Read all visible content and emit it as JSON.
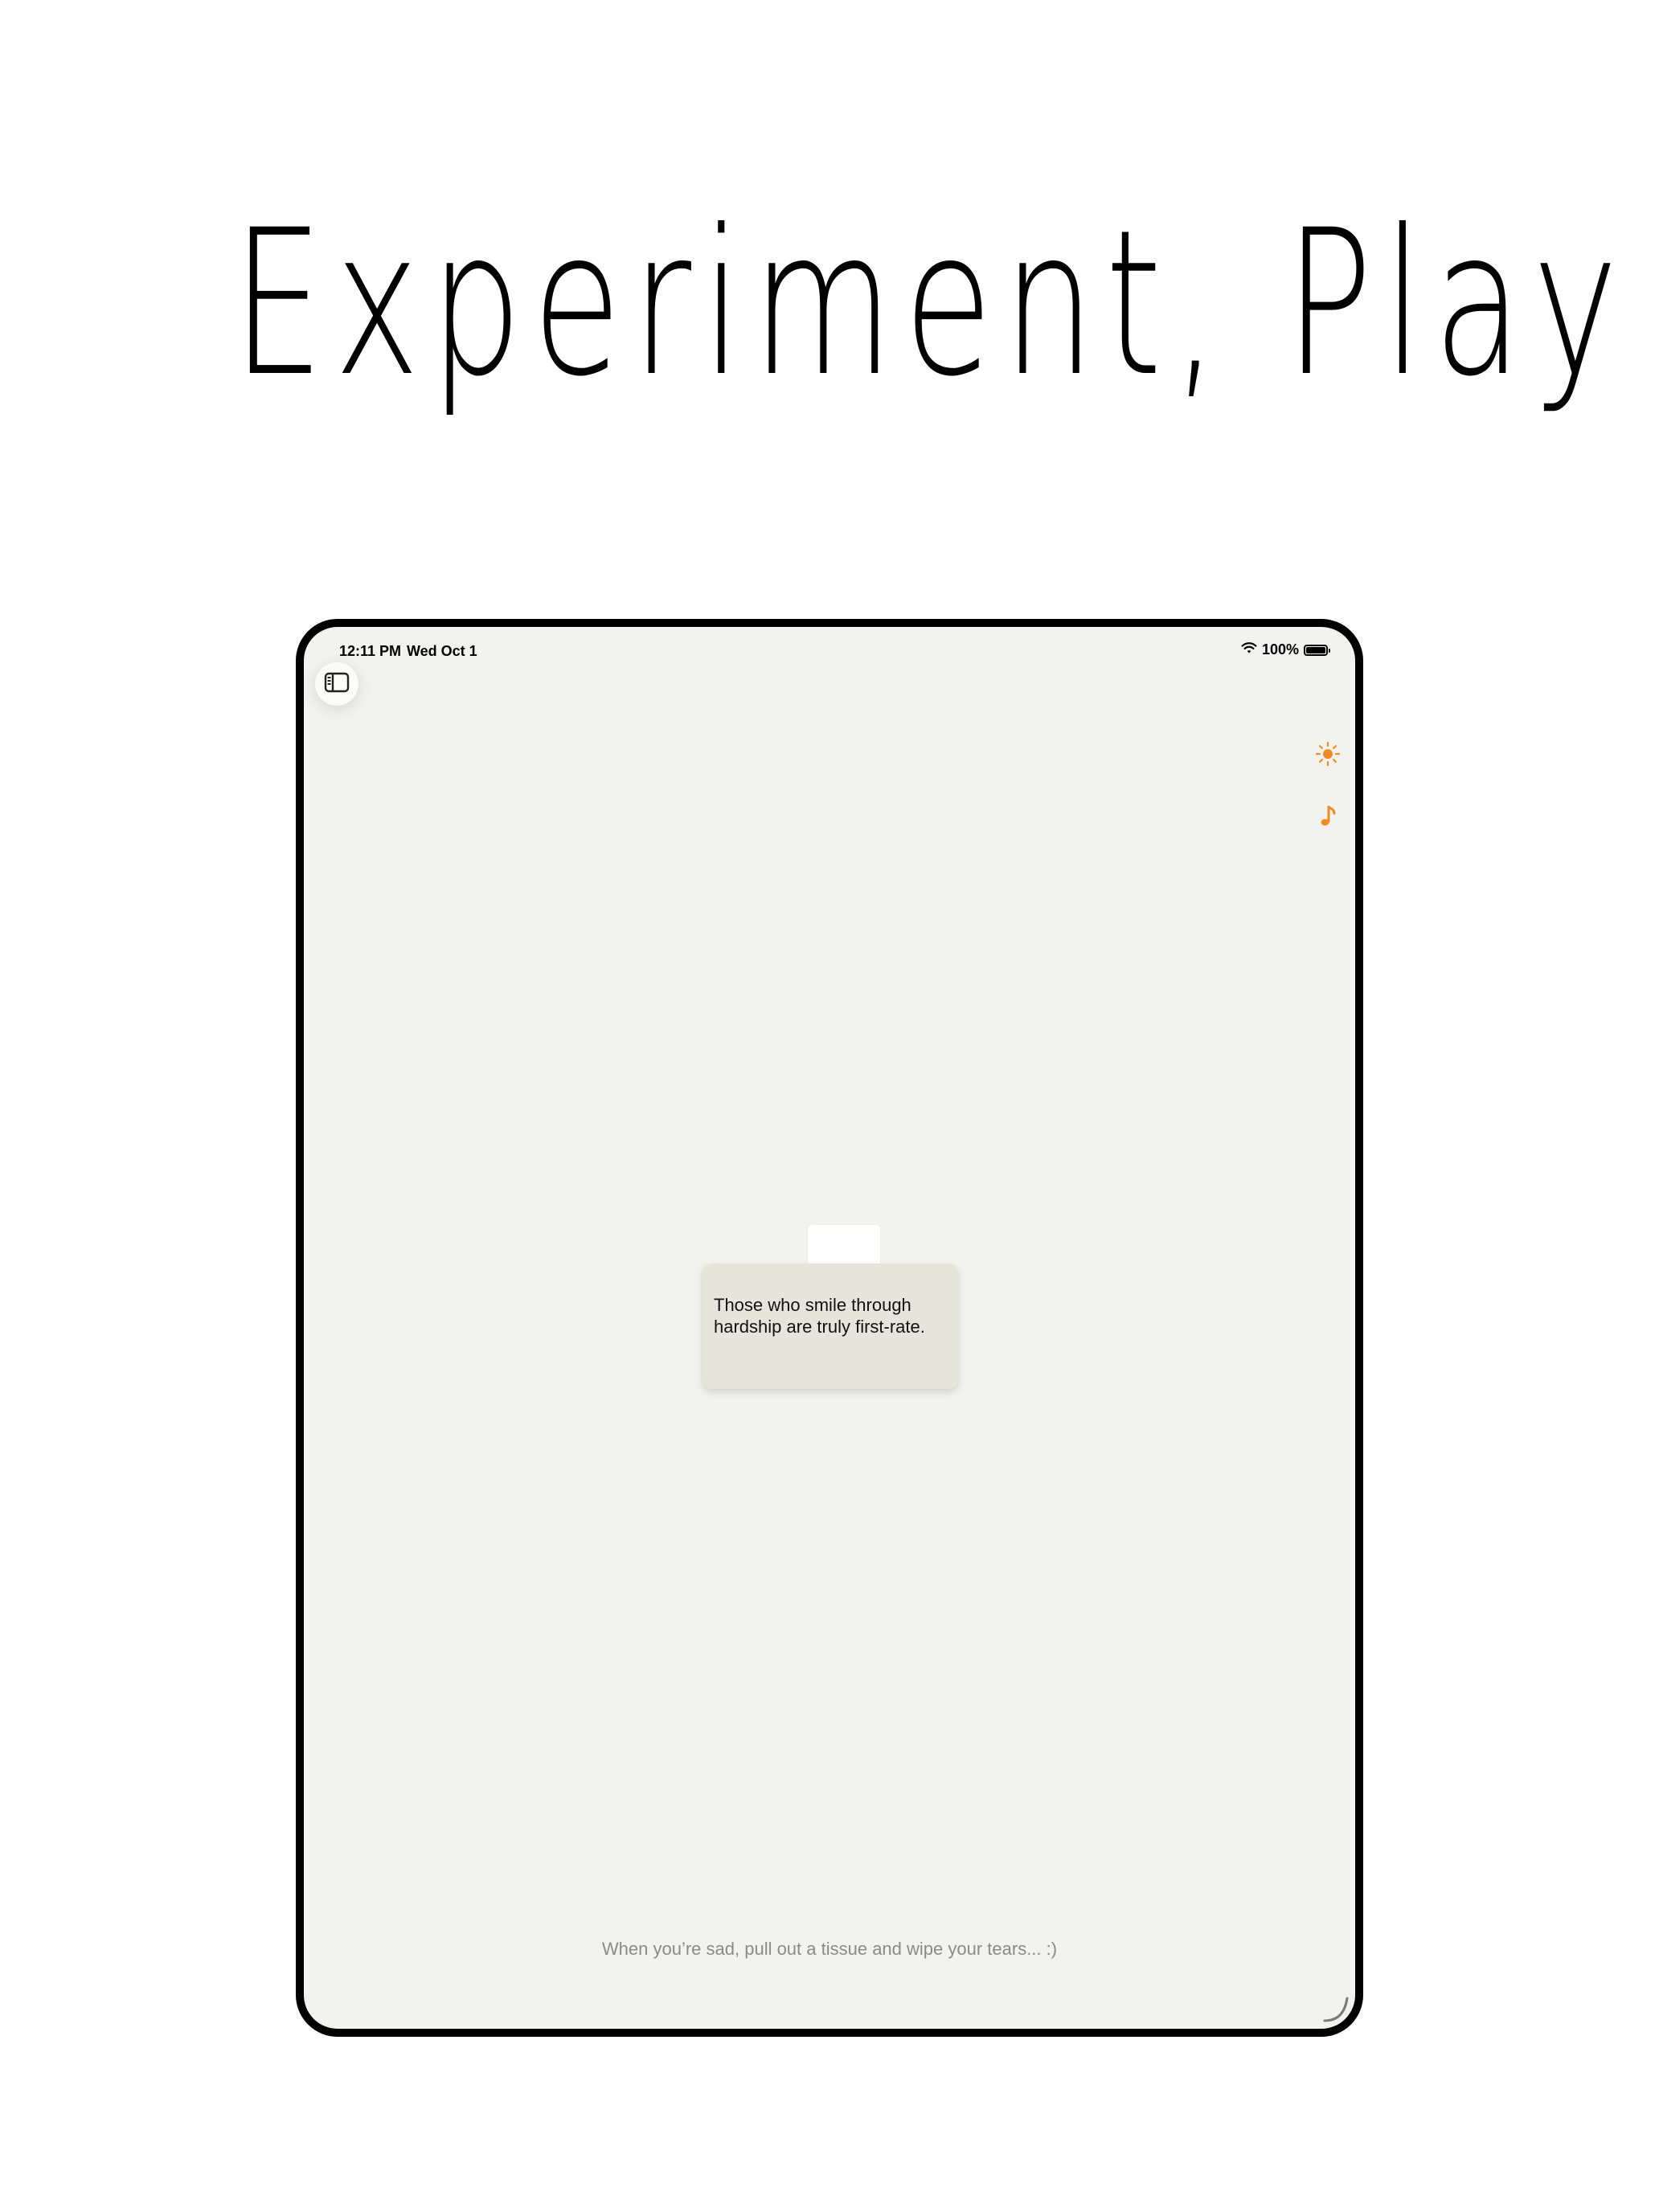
{
  "headline": "Experiment, Play",
  "status_bar": {
    "time": "12:11 PM",
    "date": "Wed Oct 1",
    "battery": "100%"
  },
  "toolbar": {
    "sidebar_icon": "sidebar-icon",
    "theme_icon": "sun-icon",
    "music_icon": "music-note-icon",
    "accent_color": "#f08a24"
  },
  "card": {
    "text": "Those who smile through hardship are truly first-rate."
  },
  "hint": "When you’re sad, pull out a tissue and wipe your tears... :)",
  "colors": {
    "background": "#f2f2ee",
    "card": "#e6e5dc",
    "frame": "#000000"
  }
}
